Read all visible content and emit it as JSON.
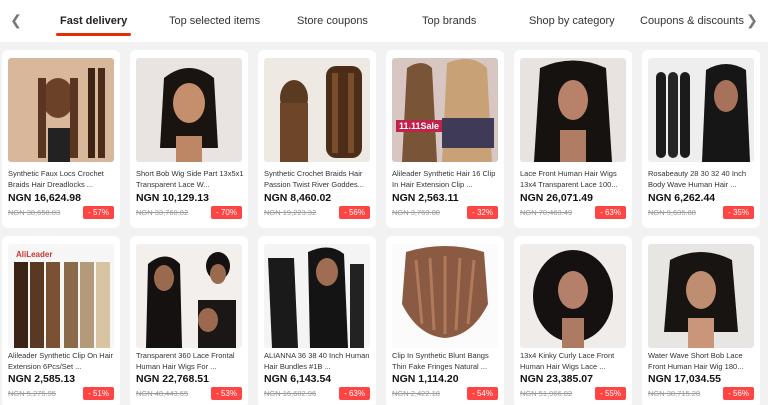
{
  "tabs": [
    {
      "label": "Fast delivery"
    },
    {
      "label": "Top selected items"
    },
    {
      "label": "Store coupons"
    },
    {
      "label": "Top brands"
    },
    {
      "label": "Shop by category"
    },
    {
      "label": "Coupons & discounts"
    }
  ],
  "nav": {
    "prev_icon": "chevron-left-icon",
    "next_icon": "chevron-right-icon"
  },
  "colors": {
    "accent": "#e62e04",
    "badge": "#ff4444"
  },
  "products": [
    {
      "title": "Synthetic Faux Locs Crochet Braids Hair Dreadlocks ...",
      "price": "NGN 16,624.98",
      "old_price": "NGN 38,658.03",
      "discount": "- 57%"
    },
    {
      "title": "Short Bob Wig Side Part 13x5x1 Transparent Lace W...",
      "price": "NGN 10,129.13",
      "old_price": "NGN 33,760.82",
      "discount": "- 70%"
    },
    {
      "title": "Synthetic Crochet Braids Hair Passion Twist River Goddes...",
      "price": "NGN 8,460.02",
      "old_price": "NGN 19,223.32",
      "discount": "- 56%"
    },
    {
      "title": "Alileader Synthetic Hair 16 Clip In Hair Extension Clip ...",
      "price": "NGN 2,563.11",
      "old_price": "NGN 3,769.80",
      "discount": "- 32%",
      "tag": "11.11Sale"
    },
    {
      "title": "Lace Front Human Hair Wigs 13x4 Transparent Lace 100...",
      "price": "NGN 26,071.49",
      "old_price": "NGN 70,463.49",
      "discount": "- 63%"
    },
    {
      "title": "Rosabeauty 28 30 32 40 Inch Body Wave Human Hair ...",
      "price": "NGN 6,262.44",
      "old_price": "NGN 9,635.88",
      "discount": "- 35%"
    },
    {
      "title": "Alileader Synthetic Clip On Hair Extension 6Pcs/Set ...",
      "price": "NGN 2,585.13",
      "old_price": "NGN 5,275.95",
      "discount": "- 51%",
      "brand": "AliLeader"
    },
    {
      "title": "Transparent 360 Lace Frontal Human Hair Wigs For ...",
      "price": "NGN 22,768.51",
      "old_price": "NGN 48,443.65",
      "discount": "- 53%"
    },
    {
      "title": "ALIANNA 36 38 40 Inch Human Hair Bundles #1B ...",
      "price": "NGN 6,143.54",
      "old_price": "NGN 16,602.96",
      "discount": "- 63%"
    },
    {
      "title": "Clip In Synthetic Blunt Bangs Thin Fake Fringes Natural ...",
      "price": "NGN 1,114.20",
      "old_price": "NGN 2,422.18",
      "discount": "- 54%"
    },
    {
      "title": "13x4 Kinky Curly Lace Front Human Hair Wigs Lace ...",
      "price": "NGN 23,385.07",
      "old_price": "NGN 51,966.82",
      "discount": "- 55%"
    },
    {
      "title": "Water Wave Short Bob Lace Front Human Hair Wig 180...",
      "price": "NGN 17,034.55",
      "old_price": "NGN 38,715.28",
      "discount": "- 56%"
    }
  ]
}
